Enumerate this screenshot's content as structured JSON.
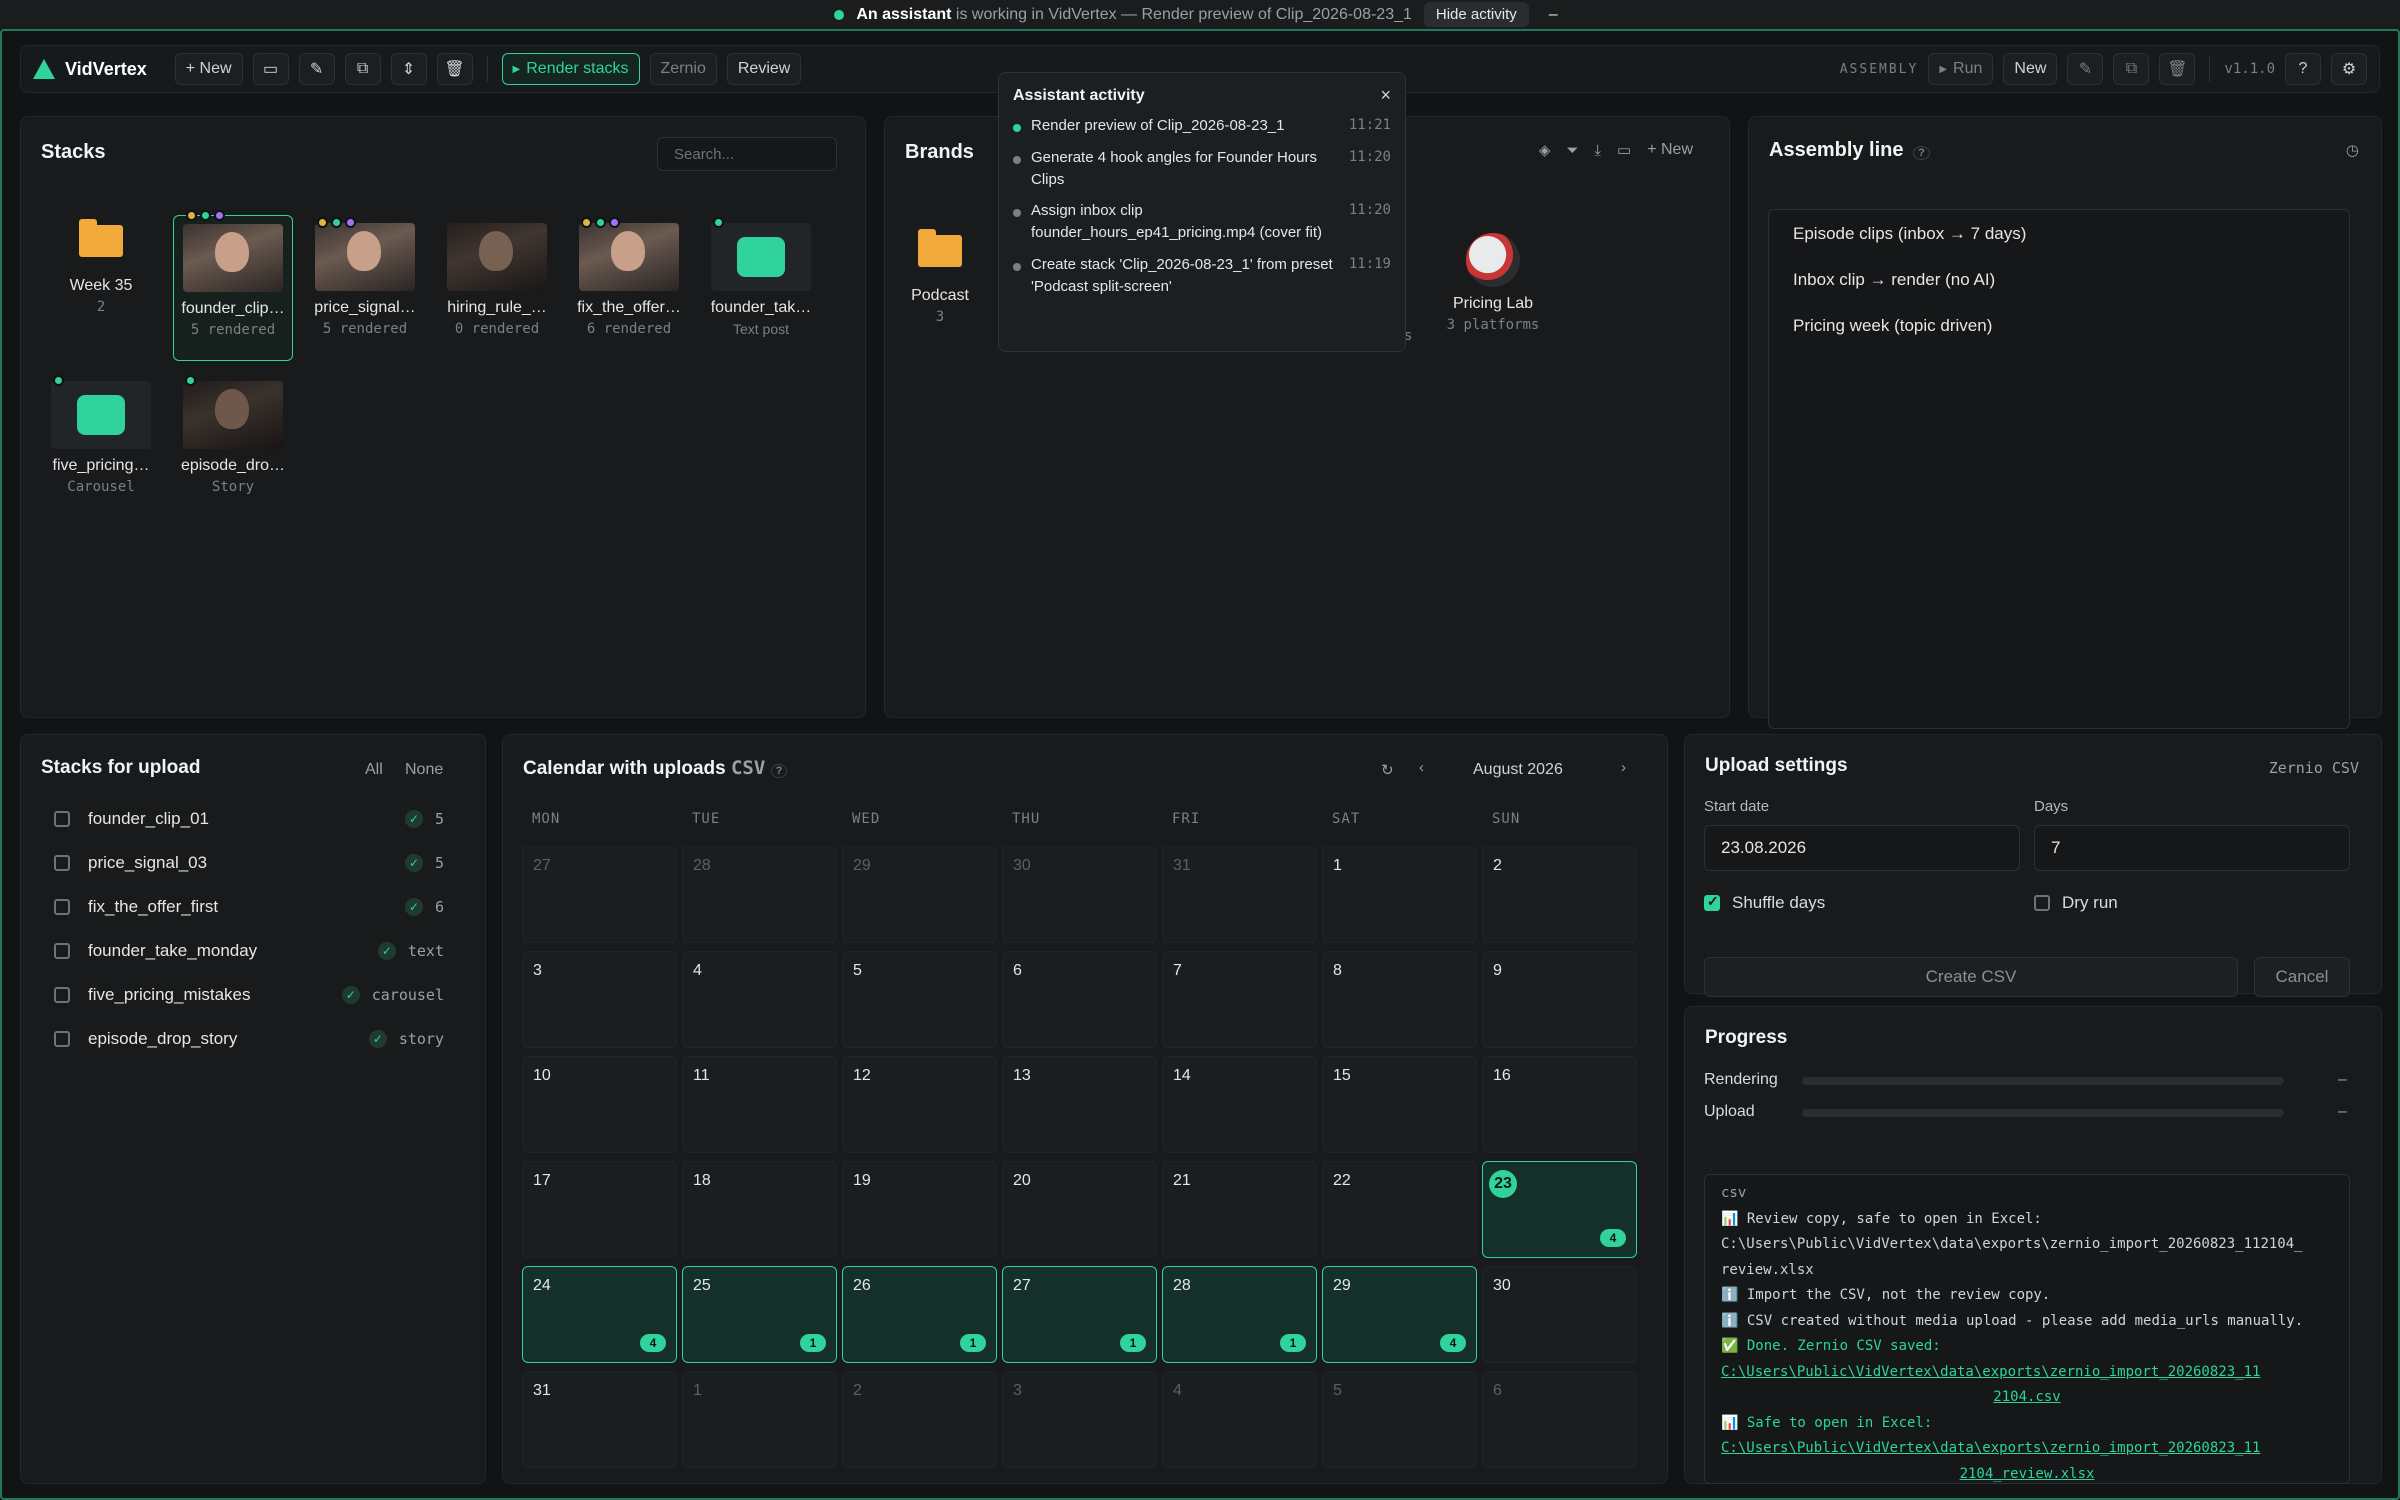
{
  "topbar": {
    "bold": "An assistant",
    "text": "is working in VidVertex",
    "sep": "— Render preview of Clip_2026-08-23_1",
    "hide": "Hide activity",
    "minimize": "–"
  },
  "toolbar": {
    "app_name": "VidVertex",
    "new": "+ New",
    "render_stacks": "Render stacks",
    "zernio": "Zernio",
    "review": "Review",
    "assembly_label": "ASSEMBLY",
    "run": "Run",
    "new2": "New",
    "version": "v1.1.0"
  },
  "stacks": {
    "title": "Stacks",
    "search_placeholder": "Search...",
    "items": [
      {
        "name": "Week 35",
        "sub": "2"
      },
      {
        "name": "founder_clip…",
        "sub": "5 rendered"
      },
      {
        "name": "price_signal…",
        "sub": "5 rendered"
      },
      {
        "name": "hiring_rule_…",
        "sub": "0 rendered"
      },
      {
        "name": "fix_the_offer…",
        "sub": "6 rendered"
      },
      {
        "name": "founder_tak…",
        "sub": "Text post"
      },
      {
        "name": "five_pricing…",
        "sub": "Carousel"
      },
      {
        "name": "episode_dro…",
        "sub": "Story"
      }
    ]
  },
  "activity": {
    "title": "Assistant activity",
    "close": "×",
    "items": [
      {
        "text": "Render preview of Clip_2026-08-23_1",
        "time": "11:21"
      },
      {
        "text": "Generate 4 hook angles for Founder Hours Clips",
        "time": "11:20"
      },
      {
        "text": "Assign inbox clip founder_hours_ep41_pricing.mp4 (cover fit)",
        "time": "11:20"
      },
      {
        "text": "Create stack 'Clip_2026-08-23_1' from preset 'Podcast split-screen'",
        "time": "11:19"
      }
    ]
  },
  "brands": {
    "title": "Brands",
    "new": "+ New",
    "items": [
      {
        "name": "Podcast",
        "sub": "3"
      },
      {
        "name": "Pricing Lab",
        "sub": "3 platforms"
      }
    ],
    "hidden_fragment": "s"
  },
  "assembly": {
    "title": "Assembly line",
    "help": "?",
    "items": [
      "Episode clips (inbox → 7 days)",
      "Inbox clip → render (no AI)",
      "Pricing week (topic driven)"
    ]
  },
  "upload_stacks": {
    "title": "Stacks for upload",
    "all": "All",
    "none": "None",
    "items": [
      {
        "name": "founder_clip_01",
        "value": "5"
      },
      {
        "name": "price_signal_03",
        "value": "5"
      },
      {
        "name": "fix_the_offer_first",
        "value": "6"
      },
      {
        "name": "founder_take_monday",
        "value": "text"
      },
      {
        "name": "five_pricing_mistakes",
        "value": "carousel"
      },
      {
        "name": "episode_drop_story",
        "value": "story"
      }
    ]
  },
  "calendar": {
    "title": "Calendar with uploads",
    "title_mono": "CSV",
    "help": "?",
    "month": "August 2026",
    "days": [
      "MON",
      "TUE",
      "WED",
      "THU",
      "FRI",
      "SAT",
      "SUN"
    ],
    "cells": [
      {
        "n": "27",
        "out": true
      },
      {
        "n": "28",
        "out": true
      },
      {
        "n": "29",
        "out": true
      },
      {
        "n": "30",
        "out": true
      },
      {
        "n": "31",
        "out": true
      },
      {
        "n": "1"
      },
      {
        "n": "2"
      },
      {
        "n": "3"
      },
      {
        "n": "4"
      },
      {
        "n": "5"
      },
      {
        "n": "6"
      },
      {
        "n": "7"
      },
      {
        "n": "8"
      },
      {
        "n": "9"
      },
      {
        "n": "10"
      },
      {
        "n": "11"
      },
      {
        "n": "12"
      },
      {
        "n": "13"
      },
      {
        "n": "14"
      },
      {
        "n": "15"
      },
      {
        "n": "16"
      },
      {
        "n": "17"
      },
      {
        "n": "18"
      },
      {
        "n": "19"
      },
      {
        "n": "20"
      },
      {
        "n": "21"
      },
      {
        "n": "22"
      },
      {
        "n": "23",
        "today": true,
        "count": "4"
      },
      {
        "n": "24",
        "count": "4"
      },
      {
        "n": "25",
        "count": "1"
      },
      {
        "n": "26",
        "count": "1"
      },
      {
        "n": "27",
        "count": "1"
      },
      {
        "n": "28",
        "count": "1"
      },
      {
        "n": "29",
        "count": "4"
      },
      {
        "n": "30"
      },
      {
        "n": "31"
      },
      {
        "n": "1",
        "out": true
      },
      {
        "n": "2",
        "out": true
      },
      {
        "n": "3",
        "out": true
      },
      {
        "n": "4",
        "out": true
      },
      {
        "n": "5",
        "out": true
      },
      {
        "n": "6",
        "out": true
      }
    ]
  },
  "upload_settings": {
    "title": "Upload settings",
    "mode": "Zernio CSV",
    "start_label": "Start date",
    "start_value": "23.08.2026",
    "days_label": "Days",
    "days_value": "7",
    "shuffle": "Shuffle days",
    "dry_run": "Dry run",
    "create": "Create CSV",
    "cancel": "Cancel"
  },
  "progress": {
    "title": "Progress",
    "rendering_label": "Rendering",
    "rendering_value": "–",
    "rendering_fraction": 0,
    "upload_label": "Upload",
    "upload_value": "–",
    "upload_fraction": 0,
    "log": {
      "l0": "csv",
      "l1": "📊 Review copy, safe to open in Excel:",
      "l2": "C:\\Users\\Public\\VidVertex\\data\\exports\\zernio_import_20260823_112104_",
      "l3": "review.xlsx",
      "l4": "ℹ️ Import the CSV, not the review copy.",
      "l5": "ℹ️ CSV created without media upload - please add media_urls manually.",
      "l6": "✅ Done. Zernio CSV saved:",
      "l7": "C:\\Users\\Public\\VidVertex\\data\\exports\\zernio_import_20260823_11",
      "l8": "2104.csv",
      "l9": "📊 Safe to open in Excel:",
      "l10": "C:\\Users\\Public\\VidVertex\\data\\exports\\zernio_import_20260823_11",
      "l11": "2104_review.xlsx"
    }
  },
  "colors": {
    "accent": "#2fd39b",
    "folder": "#f2a93b",
    "bg": "#131516"
  }
}
